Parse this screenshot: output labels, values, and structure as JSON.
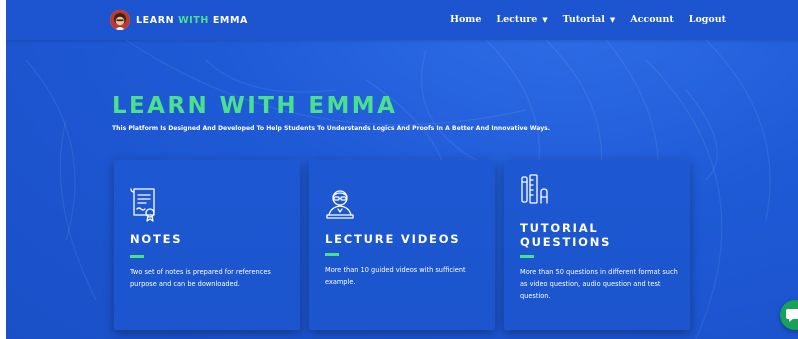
{
  "brand": {
    "name_part1": "LEARN ",
    "name_part2": "WITH",
    "name_part3": " EMMA"
  },
  "nav": {
    "items": [
      {
        "label": "Home",
        "has_dropdown": false
      },
      {
        "label": "Lecture",
        "has_dropdown": true
      },
      {
        "label": "Tutorial",
        "has_dropdown": true
      },
      {
        "label": "Account",
        "has_dropdown": false
      },
      {
        "label": "Logout",
        "has_dropdown": false
      }
    ],
    "caret_glyph": "▼"
  },
  "hero": {
    "title": "LEARN WITH EMMA",
    "subtitle": "This Platform Is Designed And Developed To Help Students To Understands Logics And Proofs In A Better And Innovative Ways."
  },
  "cards": [
    {
      "title": "NOTES",
      "text": "Two set of notes is prepared for references purpose and can be downloaded.",
      "icon": "certificate-document-icon"
    },
    {
      "title": "LECTURE VIDEOS",
      "text": "More than 10 guided videos with sufficient example.",
      "icon": "lecturer-icon"
    },
    {
      "title": "TUTORIAL QUESTIONS",
      "text": "More than 50 questions in different format such as video question, audio question and test question.",
      "icon": "stationery-icon"
    }
  ],
  "colors": {
    "background": "#1f5ad6",
    "navbar": "#1c55cf",
    "accent_green": "#4be08f",
    "card": "#1d58d2",
    "chat_button": "#19a05a"
  }
}
